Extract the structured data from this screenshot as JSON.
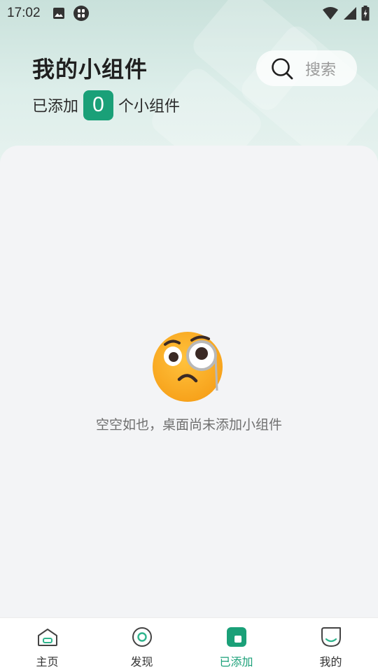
{
  "status_bar": {
    "time": "17:02",
    "icons": [
      "image-icon",
      "app-notification-icon",
      "wifi-icon",
      "cellular-signal-icon",
      "battery-charging-icon"
    ]
  },
  "header": {
    "title": "我的小组件",
    "added_prefix": "已添加",
    "added_count": "0",
    "added_suffix": "个小组件"
  },
  "search": {
    "label": "搜索",
    "icon": "search-icon"
  },
  "empty_state": {
    "icon": "monocle-face-emoji",
    "message": "空空如也，桌面尚未添加小组件"
  },
  "bottom_nav": {
    "items": [
      {
        "label": "主页",
        "icon": "home-icon",
        "active": false
      },
      {
        "label": "发现",
        "icon": "discover-icon",
        "active": false
      },
      {
        "label": "已添加",
        "icon": "added-widgets-icon",
        "active": true
      },
      {
        "label": "我的",
        "icon": "profile-icon",
        "active": false
      }
    ]
  },
  "colors": {
    "accent": "#1aa078",
    "content_bg": "#f3f4f6",
    "header_bg": "#d3e8e2"
  }
}
